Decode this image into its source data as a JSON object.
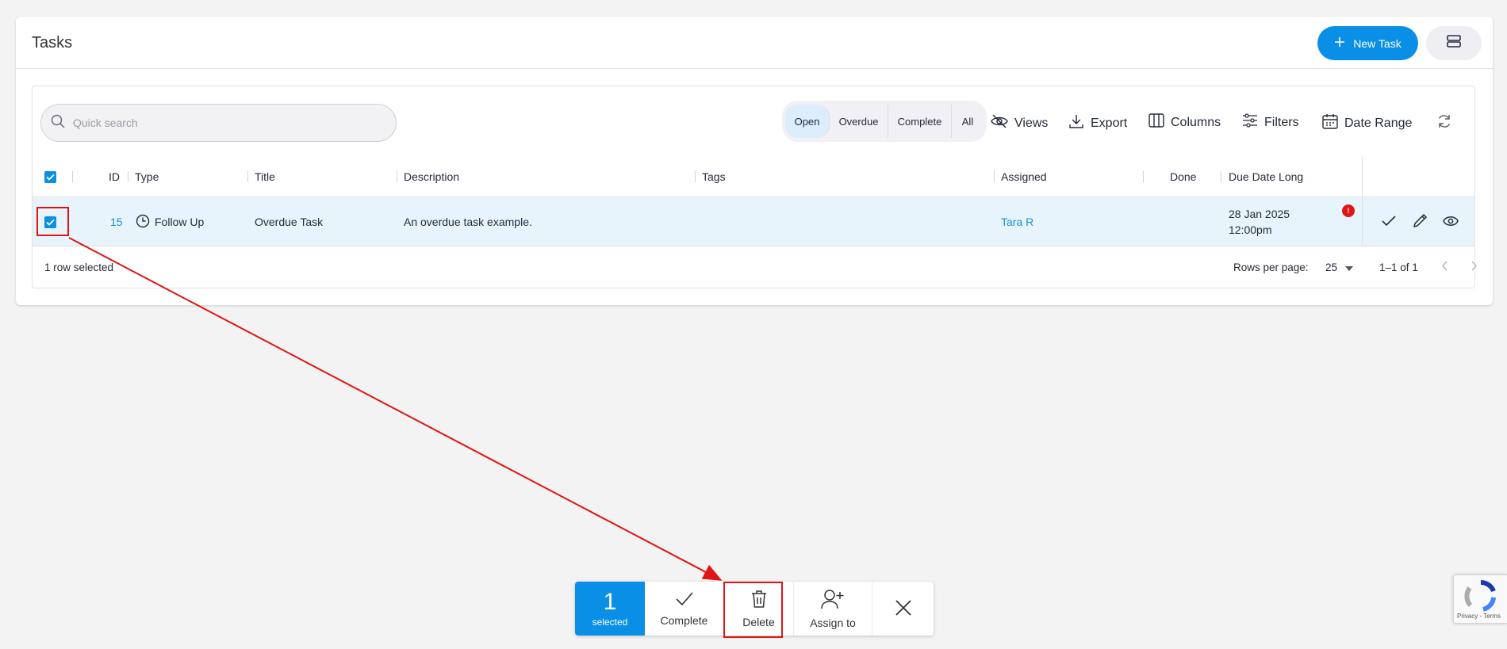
{
  "header": {
    "title": "Tasks",
    "new_task_label": "New Task"
  },
  "toolbar": {
    "search_placeholder": "Quick search",
    "status_filters": [
      "Open",
      "Overdue",
      "Complete",
      "All"
    ],
    "active_status": "Open",
    "views_label": "Views",
    "export_label": "Export",
    "columns_label": "Columns",
    "filters_label": "Filters",
    "date_range_label": "Date Range"
  },
  "table": {
    "columns": [
      "ID",
      "Type",
      "Title",
      "Description",
      "Tags",
      "Assigned",
      "Done",
      "Due Date Long"
    ],
    "rows": [
      {
        "selected": true,
        "id": "15",
        "type": "Follow Up",
        "title": "Overdue Task",
        "description": "An overdue task example.",
        "tags": "",
        "assigned": "Tara R",
        "done": "",
        "due_date": "28 Jan 2025",
        "due_time": "12:00pm",
        "overdue_badge": "!"
      }
    ]
  },
  "footer": {
    "selection_text": "1 row selected",
    "rows_per_page_label": "Rows per page:",
    "rows_per_page_value": "25",
    "range_text": "1–1 of 1"
  },
  "action_bar": {
    "selected_count": "1",
    "selected_label": "selected",
    "complete_label": "Complete",
    "delete_label": "Delete",
    "assign_label": "Assign to"
  },
  "recaptcha": {
    "text": "Privacy - Terms"
  },
  "colors": {
    "accent": "#0a8fe6",
    "selected_row": "#e7f4fc",
    "link": "#1a8fd9",
    "overdue": "#e01515",
    "annotation": "#e01515"
  }
}
